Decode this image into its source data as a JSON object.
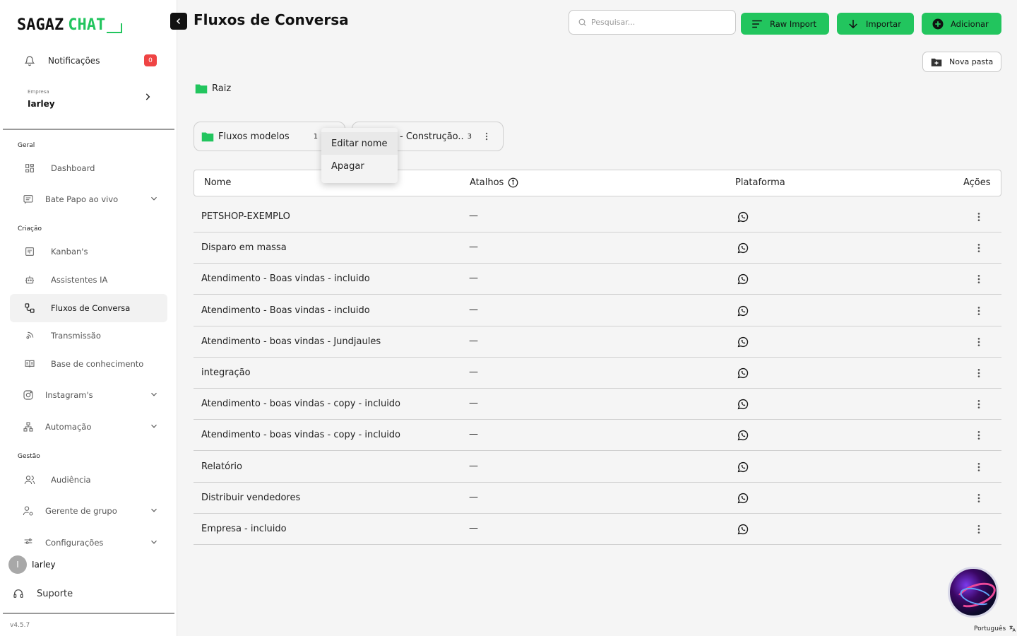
{
  "app": {
    "logo_part1": "SAGAZ",
    "logo_part2": "CHAT",
    "version": "v4.5.7"
  },
  "sidebar": {
    "notifications_label": "Notificações",
    "notifications_count": "0",
    "company_caption": "Empresa",
    "company_name": "Iarley",
    "sections": {
      "geral": "Geral",
      "criacao": "Criação",
      "gestao": "Gestão"
    },
    "items": [
      {
        "label": "Dashboard"
      },
      {
        "label": "Bate Papo ao vivo"
      },
      {
        "label": "Kanban's"
      },
      {
        "label": "Assistentes IA"
      },
      {
        "label": "Fluxos de Conversa"
      },
      {
        "label": "Transmissão"
      },
      {
        "label": "Base de conhecimento"
      },
      {
        "label": "Instagram's"
      },
      {
        "label": "Automação"
      },
      {
        "label": "Audiência"
      },
      {
        "label": "Gerente de grupo"
      },
      {
        "label": "Configurações"
      }
    ],
    "user_initial": "I",
    "user_name": "Iarley",
    "support_label": "Suporte"
  },
  "header": {
    "title": "Fluxos de Conversa",
    "search_placeholder": "Pesquisar...",
    "raw_import_label": "Raw Import",
    "import_label": "Importar",
    "add_label": "Adicionar",
    "new_folder_label": "Nova pasta"
  },
  "breadcrumb": {
    "root": "Raiz"
  },
  "folders": [
    {
      "name": "Fluxos modelos",
      "count": "1"
    },
    {
      "name": "- Construção..",
      "count": "3"
    }
  ],
  "context_menu": {
    "edit": "Editar nome",
    "delete": "Apagar"
  },
  "table": {
    "headers": {
      "name": "Nome",
      "shortcuts": "Atalhos",
      "platform": "Plataforma",
      "actions": "Ações"
    },
    "rows": [
      {
        "name": "PETSHOP-EXEMPLO",
        "shortcuts": "—"
      },
      {
        "name": "Disparo em massa",
        "shortcuts": "—"
      },
      {
        "name": "Atendimento - Boas vindas - incluido",
        "shortcuts": "—"
      },
      {
        "name": "Atendimento - Boas vindas - incluido",
        "shortcuts": "—"
      },
      {
        "name": "Atendimento - boas vindas - Jundjaules",
        "shortcuts": "—"
      },
      {
        "name": "integração",
        "shortcuts": "—"
      },
      {
        "name": "Atendimento - boas vindas - copy - incluido",
        "shortcuts": "—"
      },
      {
        "name": "Atendimento - boas vindas - copy - incluido",
        "shortcuts": "—"
      },
      {
        "name": "Relatório",
        "shortcuts": "—"
      },
      {
        "name": "Distribuir vendedores",
        "shortcuts": "—"
      },
      {
        "name": "Empresa - incluido",
        "shortcuts": "—"
      }
    ]
  },
  "footer": {
    "language": "Português"
  },
  "colors": {
    "accent": "#22c55e",
    "badge": "#ef4444",
    "dark": "#111111"
  }
}
